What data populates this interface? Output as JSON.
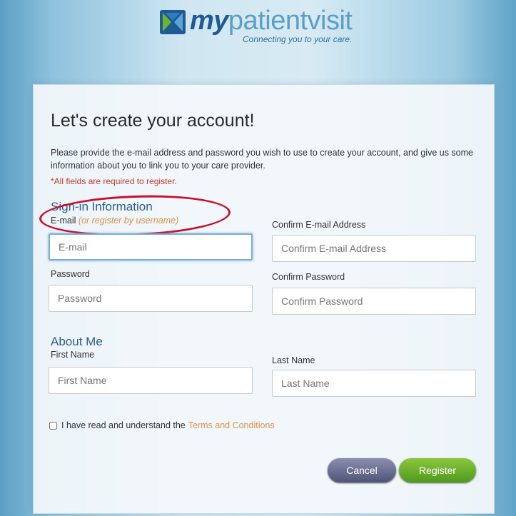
{
  "logo": {
    "brand_prefix": "my",
    "brand_suffix": "patientvisit",
    "tagline": "Connecting you to your care."
  },
  "form": {
    "title": "Let's create your account!",
    "intro": "Please provide the e-mail address and password you wish to use to create your account, and give us some information about you to link you to your care provider.",
    "required_note": "*All fields are required to register.",
    "signin_heading": "Sign-in Information",
    "about_heading": "About Me",
    "email": {
      "label": "E-mail",
      "hint": "(or register by username)",
      "placeholder": "E-mail",
      "value": ""
    },
    "confirm_email": {
      "label": "Confirm E-mail Address",
      "placeholder": "Confirm E-mail Address",
      "value": ""
    },
    "password": {
      "label": "Password",
      "placeholder": "Password",
      "value": ""
    },
    "confirm_password": {
      "label": "Confirm Password",
      "placeholder": "Confirm Password",
      "value": ""
    },
    "first_name": {
      "label": "First Name",
      "placeholder": "First Name",
      "value": ""
    },
    "last_name": {
      "label": "Last Name",
      "placeholder": "Last Name",
      "value": ""
    },
    "terms": {
      "text": "I have read and understand the",
      "link": "Terms and Conditions",
      "checked": false
    },
    "cancel_label": "Cancel",
    "register_label": "Register"
  },
  "colors": {
    "accent_blue": "#2b5d8e",
    "highlight_red": "#c8102e",
    "register_green": "#6fb52c",
    "cancel_slate": "#5f6587",
    "link_orange": "#d9904a"
  },
  "icons": [
    "logo-mark-icon"
  ]
}
